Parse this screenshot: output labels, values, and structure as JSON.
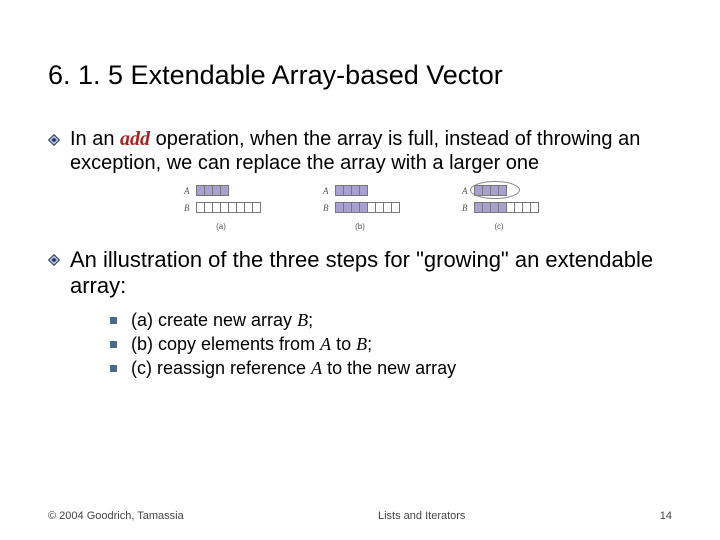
{
  "title": "6. 1. 5 Extendable Array-based Vector",
  "bullet1": {
    "prefix": "In an ",
    "emph": "add",
    "suffix": " operation, when the array is full, instead of throwing an exception, we can replace the array with a larger one"
  },
  "bullet2": "An illustration of the three steps for \"growing\" an extendable array:",
  "subitems": [
    {
      "pre": "(a) create new array ",
      "it1": "B",
      "post": ";"
    },
    {
      "pre": "(b) copy elements from ",
      "it1": "A",
      "mid": " to ",
      "it2": "B",
      "post": ";"
    },
    {
      "pre": "(c) reassign reference ",
      "it1": "A",
      "post": " to the new array"
    }
  ],
  "diagram": {
    "rowLabels": {
      "a": "A",
      "b": "B"
    },
    "captions": {
      "a": "(a)",
      "b": "(b)",
      "c": "(c)"
    }
  },
  "footer": {
    "copyright": "© 2004 Goodrich, Tamassia",
    "center": "Lists and Iterators",
    "page": "14"
  }
}
